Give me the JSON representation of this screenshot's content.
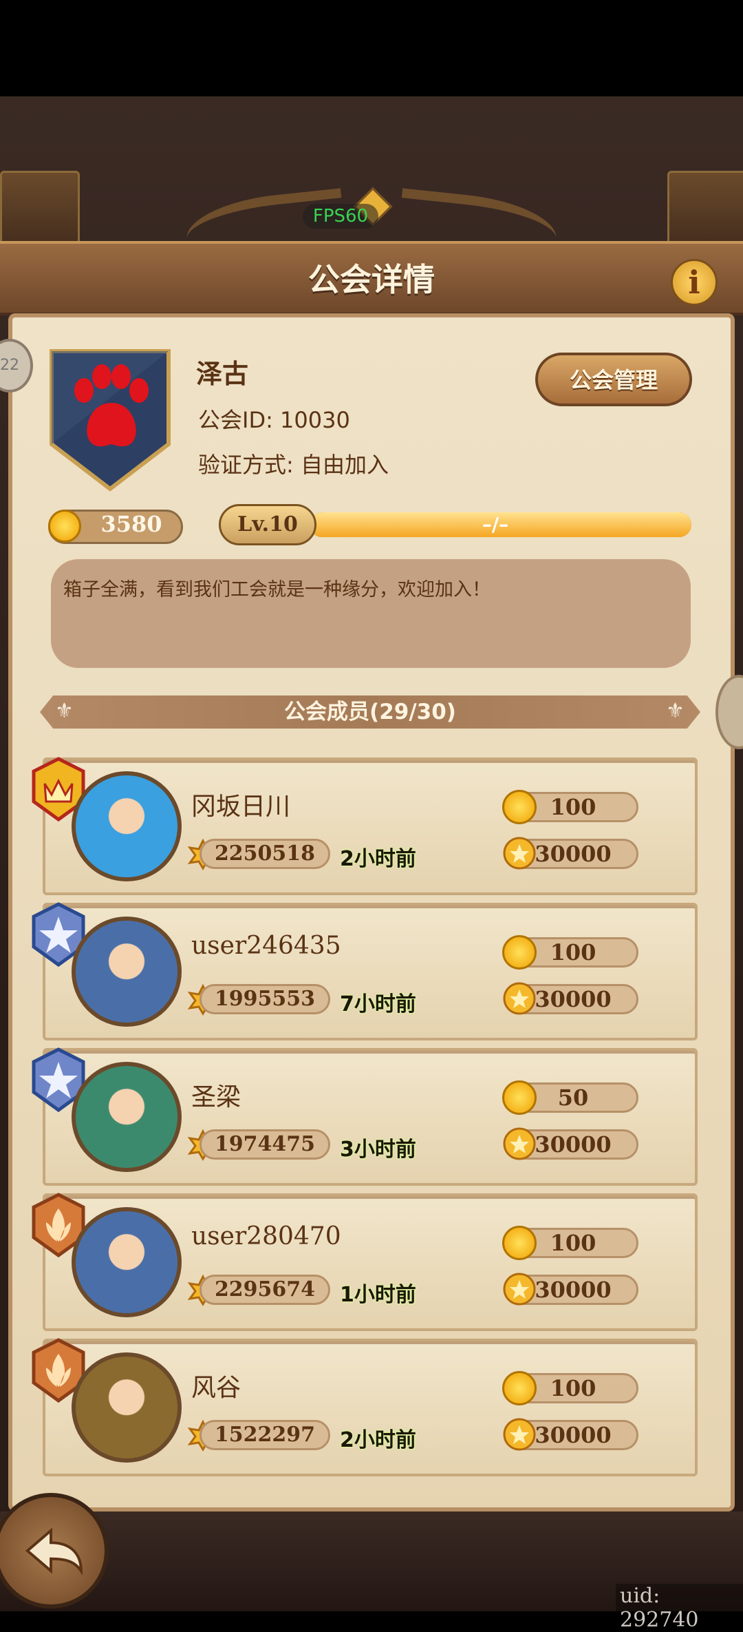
{
  "overlay": {
    "fps": "FPS60",
    "side_badge": "22",
    "uid": "uid: 292740"
  },
  "header": {
    "title": "公会详情",
    "info_icon": "i"
  },
  "guild": {
    "name": "泽古",
    "id_text": "公会ID: 10030",
    "join_text": "验证方式: 自由加入",
    "manage_label": "公会管理",
    "coins": "3580",
    "level": "Lv.10",
    "exp_text": "–/–",
    "exp_progress": 1.0,
    "description": "箱子全满，看到我们工会就是一种缘分，欢迎加入！",
    "emblem_icon": "paw-emblem"
  },
  "members_title": "公会成员(29/30)",
  "members": [
    {
      "name": "冈坂日川",
      "rank": "crown-medal",
      "power": "2250518",
      "time": "2小时前",
      "coin": "100",
      "contribution": "30000"
    },
    {
      "name": "user246435",
      "rank": "star-medal",
      "power": "1995553",
      "time": "7小时前",
      "coin": "100",
      "contribution": "30000"
    },
    {
      "name": "圣梁",
      "rank": "star-medal",
      "power": "1974475",
      "time": "3小时前",
      "coin": "50",
      "contribution": "30000"
    },
    {
      "name": "user280470",
      "rank": "leaf-medal",
      "power": "2295674",
      "time": "1小时前",
      "coin": "100",
      "contribution": "30000"
    },
    {
      "name": "风谷",
      "rank": "leaf-medal",
      "power": "1522297",
      "time": "2小时前",
      "coin": "100",
      "contribution": "30000"
    }
  ],
  "colors": {
    "parchment": "#efe2c7",
    "brown_text": "#5a3214",
    "header": "#8a5c36",
    "gold": "#f5a623"
  }
}
